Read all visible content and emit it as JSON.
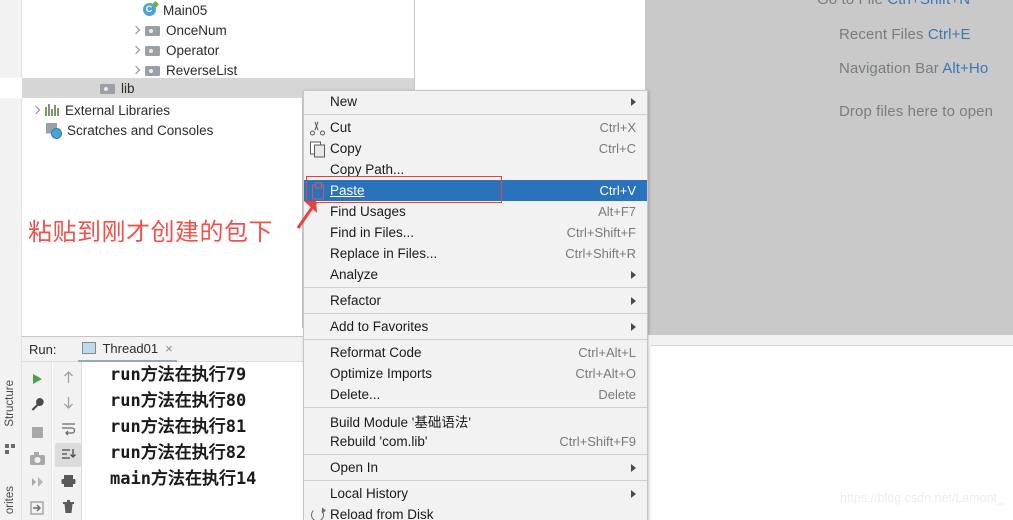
{
  "project_tree": {
    "items": [
      {
        "label": "Main05",
        "icon": "java-class-icon",
        "expandable": false,
        "indent": 120
      },
      {
        "label": "OnceNum",
        "icon": "folder-icon",
        "expandable": true,
        "indent": 96
      },
      {
        "label": "Operator",
        "icon": "folder-icon",
        "expandable": true,
        "indent": 96
      },
      {
        "label": "ReverseList",
        "icon": "folder-icon",
        "expandable": true,
        "indent": 96
      }
    ],
    "selected_item": {
      "label": "lib",
      "icon": "folder-icon"
    },
    "lower_items": [
      {
        "label": "External Libraries",
        "icon": "external-libraries-icon",
        "expandable": true,
        "indent": 8
      },
      {
        "label": "Scratches and Consoles",
        "icon": "scratches-icon",
        "expandable": false,
        "indent": 24
      }
    ]
  },
  "annotation": {
    "text": "粘贴到刚才创建的包下",
    "color": "#f4504a"
  },
  "context_menu": {
    "items": [
      {
        "type": "item",
        "label": "New",
        "accel": "",
        "submenu": true,
        "icon": "",
        "underline": ""
      },
      {
        "type": "sep"
      },
      {
        "type": "item",
        "label": "Cut",
        "accel": "Ctrl+X",
        "submenu": false,
        "icon": "cut-icon",
        "underline": "t"
      },
      {
        "type": "item",
        "label": "Copy",
        "accel": "Ctrl+C",
        "submenu": false,
        "icon": "copy-icon",
        "underline": "C"
      },
      {
        "type": "item",
        "label": "Copy Path...",
        "accel": "",
        "submenu": false,
        "icon": "",
        "underline": ""
      },
      {
        "type": "item",
        "label": "Paste",
        "accel": "Ctrl+V",
        "submenu": false,
        "icon": "paste-icon",
        "underline": "P",
        "selected": true
      },
      {
        "type": "item",
        "label": "Find Usages",
        "accel": "Alt+F7",
        "submenu": false,
        "icon": "",
        "underline": "U"
      },
      {
        "type": "item",
        "label": "Find in Files...",
        "accel": "Ctrl+Shift+F",
        "submenu": false,
        "icon": "",
        "underline": ""
      },
      {
        "type": "item",
        "label": "Replace in Files...",
        "accel": "Ctrl+Shift+R",
        "submenu": false,
        "icon": "",
        "underline": "a"
      },
      {
        "type": "item",
        "label": "Analyze",
        "accel": "",
        "submenu": true,
        "icon": "",
        "underline": ""
      },
      {
        "type": "sep"
      },
      {
        "type": "item",
        "label": "Refactor",
        "accel": "",
        "submenu": true,
        "icon": "",
        "underline": "R"
      },
      {
        "type": "sep"
      },
      {
        "type": "item",
        "label": "Add to Favorites",
        "accel": "",
        "submenu": true,
        "icon": "",
        "underline": "F"
      },
      {
        "type": "sep"
      },
      {
        "type": "item",
        "label": "Reformat Code",
        "accel": "Ctrl+Alt+L",
        "submenu": false,
        "icon": "",
        "underline": "R"
      },
      {
        "type": "item",
        "label": "Optimize Imports",
        "accel": "Ctrl+Alt+O",
        "submenu": false,
        "icon": "",
        "underline": "z"
      },
      {
        "type": "item",
        "label": "Delete...",
        "accel": "Delete",
        "submenu": false,
        "icon": "",
        "underline": "D"
      },
      {
        "type": "sep"
      },
      {
        "type": "item",
        "label": "Build Module '基础语法'",
        "accel": "",
        "submenu": false,
        "icon": "",
        "underline": "M"
      },
      {
        "type": "item",
        "label": "Rebuild 'com.lib'",
        "accel": "Ctrl+Shift+F9",
        "submenu": false,
        "icon": "",
        "underline": "e"
      },
      {
        "type": "sep"
      },
      {
        "type": "item",
        "label": "Open In",
        "accel": "",
        "submenu": true,
        "icon": "",
        "underline": ""
      },
      {
        "type": "sep"
      },
      {
        "type": "item",
        "label": "Local History",
        "accel": "",
        "submenu": true,
        "icon": "",
        "underline": "H"
      },
      {
        "type": "item",
        "label": "Reload from Disk",
        "accel": "",
        "submenu": false,
        "icon": "reload-icon",
        "underline": ""
      }
    ],
    "highlight_color": "#2a72bb",
    "background_color": "#f2f2f2"
  },
  "editor_hints": {
    "rows": [
      {
        "label": "Recent Files",
        "key": "Ctrl+E"
      },
      {
        "label": "Navigation Bar",
        "key": "Alt+Ho"
      },
      {
        "label": "Drop files here to open",
        "key": ""
      }
    ],
    "text_color": "#787d7f",
    "key_color": "#3d77b5"
  },
  "run_window": {
    "label": "Run:",
    "tab": {
      "title": "Thread01",
      "close": "×",
      "icon": "run-config-icon"
    },
    "left_toolbar": [
      {
        "icon": "rerun-icon"
      },
      {
        "icon": "settings-wrench-icon"
      },
      {
        "icon": "stop-icon"
      },
      {
        "icon": "camera-icon"
      },
      {
        "icon": "thread-dump-icon"
      },
      {
        "icon": "export-icon"
      }
    ],
    "right_toolbar": [
      {
        "icon": "arrow-up-icon",
        "active": false
      },
      {
        "icon": "arrow-down-icon",
        "active": false
      },
      {
        "icon": "soft-wrap-icon",
        "active": false
      },
      {
        "icon": "scroll-to-end-icon",
        "active": true
      },
      {
        "icon": "print-icon",
        "active": false
      },
      {
        "icon": "trash-icon",
        "active": false
      }
    ],
    "console_lines": [
      "run方法在执行79",
      "run方法在执行80",
      "run方法在执行81",
      "run方法在执行82",
      "main方法在执行14"
    ]
  },
  "side_strip": {
    "structure_label": "Structure",
    "favorites_label": "orites"
  },
  "watermark": {
    "text": "https://blog.csdn.net/Lamont_"
  }
}
